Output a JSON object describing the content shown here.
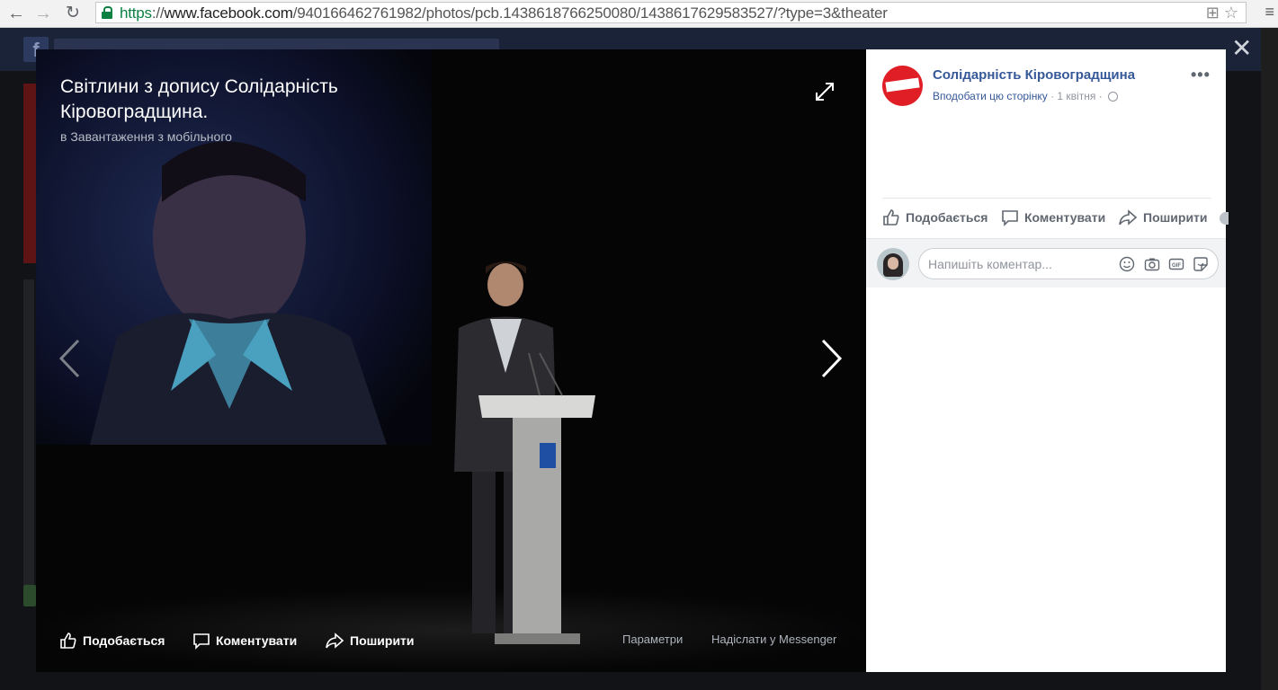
{
  "browser": {
    "url_scheme": "https",
    "url_sep": "://",
    "url_host": "www.facebook.com",
    "url_path": "/940166462761982/photos/pcb.1438618766250080/1438617629583527/?type=3&theater"
  },
  "viewer": {
    "title": "Світлини з допису Солідарність Кіровоградщина.",
    "subtitle": "в Завантаження з мобільного",
    "actions": {
      "like": "Подобається",
      "comment": "Коментувати",
      "share": "Поширити",
      "options": "Параметри",
      "send_messenger": "Надіслати у Messenger"
    }
  },
  "post": {
    "page_name": "Солідарність Кіровоградщина",
    "follow_label": "Вподобати цю сторінку",
    "date": "1 квітня",
    "actions": {
      "like": "Подобається",
      "comment": "Коментувати",
      "share": "Поширити"
    },
    "comment_placeholder": "Напишіть коментар..."
  },
  "colors": {
    "link_blue": "#365899",
    "brand_red": "#e01e26",
    "secure_green": "#0b8043"
  },
  "icons": [
    "back-arrow-icon",
    "forward-arrow-icon",
    "reload-icon",
    "lock-icon",
    "translate-icon",
    "star-icon",
    "menu-icon",
    "close-icon",
    "expand-icon",
    "chevron-left-icon",
    "chevron-right-icon",
    "like-icon",
    "comment-icon",
    "share-icon",
    "globe-icon",
    "more-icon",
    "emoji-icon",
    "camera-icon",
    "gif-icon",
    "sticker-icon"
  ]
}
